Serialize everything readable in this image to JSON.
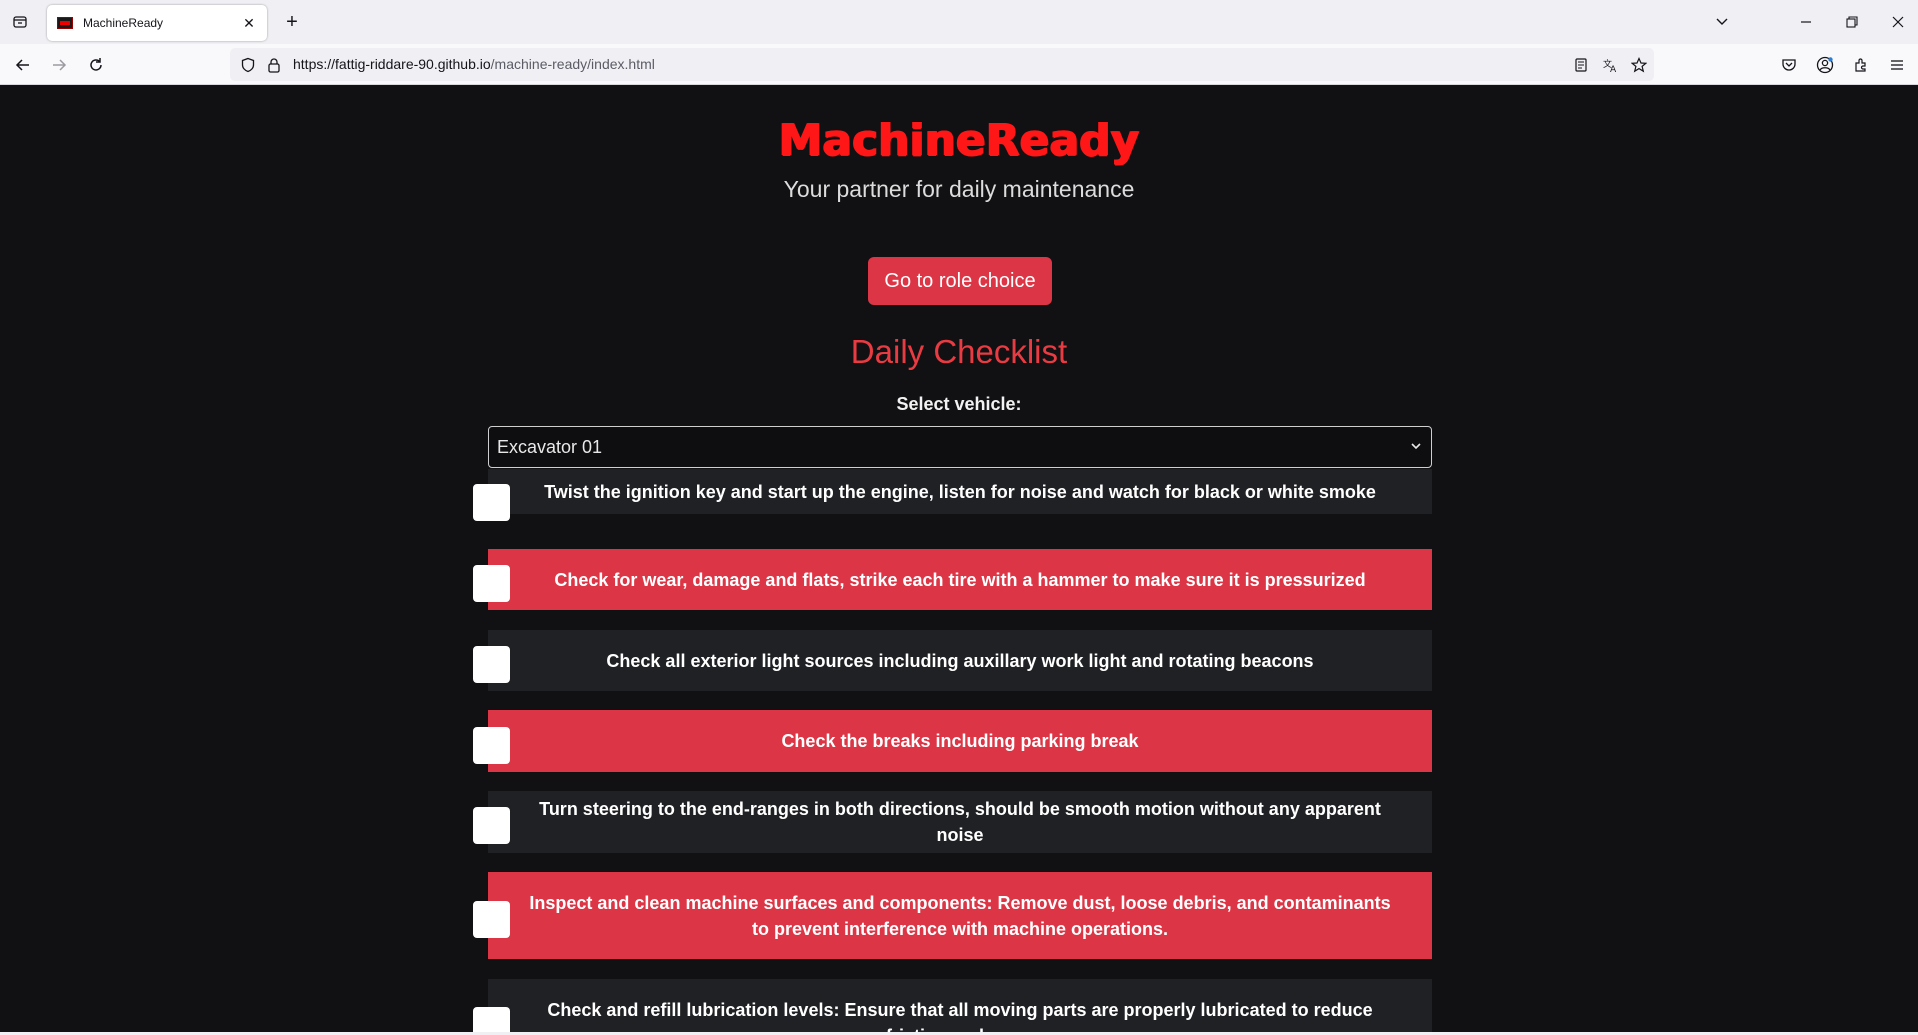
{
  "browser": {
    "tab_title": "MachineReady",
    "url_host": "https://fattig-riddare-90.github.io",
    "url_path": "/machine-ready/index.html"
  },
  "header": {
    "brand": "MachineReady",
    "tagline": "Your partner for daily maintenance",
    "role_button": "Go to role choice"
  },
  "checklist": {
    "title": "Daily Checklist",
    "select_label": "Select vehicle:",
    "selected_vehicle": "Excavator 01",
    "items": [
      {
        "text": "Twist the ignition key and start up the engine, listen for noise and watch for black or white smoke",
        "style": "dark"
      },
      {
        "text": "Check for wear, damage and flats, strike each tire with a hammer to make sure it is pressurized",
        "style": "red"
      },
      {
        "text": "Check all exterior light sources including auxillary work light and rotating beacons",
        "style": "dark"
      },
      {
        "text": "Check the breaks including parking break",
        "style": "red"
      },
      {
        "text": "Turn steering to the end-ranges in both directions, should be smooth motion without any apparent noise",
        "style": "dark"
      },
      {
        "text": "Inspect and clean machine surfaces and components: Remove dust, loose debris, and contaminants to prevent interference with machine operations.",
        "style": "red"
      },
      {
        "text": "Check and refill lubrication levels: Ensure that all moving parts are properly lubricated to reduce friction and wear.",
        "style": "dark"
      }
    ]
  },
  "colors": {
    "page_background": "#111113",
    "brand_red": "#ff1616",
    "accent_red": "#dc3545",
    "dark_row": "#202124"
  }
}
